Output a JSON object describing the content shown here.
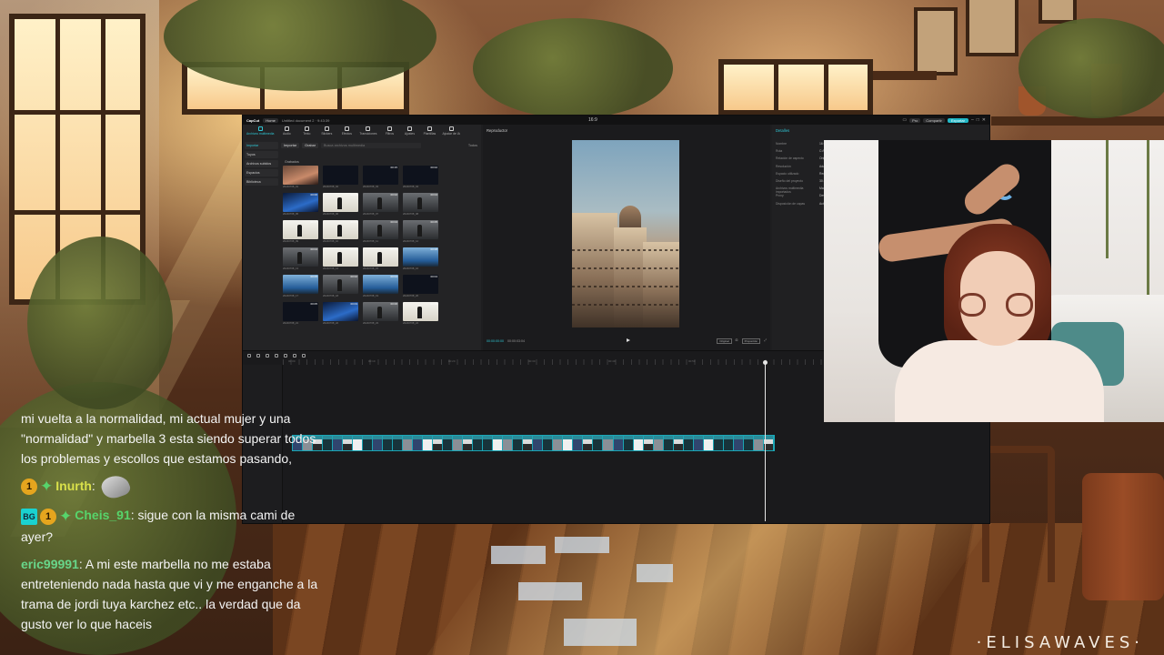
{
  "editor": {
    "titlebar": {
      "app_name": "CapCut",
      "home_label": "Home",
      "document_tab": "Untitled document 2 · 9:43:39",
      "center_title": "16:9",
      "pro_label": "Pro",
      "share_label": "Compartir",
      "export_label": "Exportar"
    },
    "toolbar": [
      {
        "label": "Archivos multimedia",
        "active": true
      },
      {
        "label": "Audio"
      },
      {
        "label": "Texto"
      },
      {
        "label": "Stickers"
      },
      {
        "label": "Efectos"
      },
      {
        "label": "Transiciones"
      },
      {
        "label": "Filtros"
      },
      {
        "label": "Ajustes"
      },
      {
        "label": "Plantillas"
      },
      {
        "label": "Ajustar de IA"
      }
    ],
    "sidebar": [
      {
        "label": "Importar",
        "active": true
      },
      {
        "label": "Tuyos"
      },
      {
        "label": "Archivos subidos"
      },
      {
        "label": "Espacios"
      },
      {
        "label": "Biblioteca"
      }
    ],
    "media_header": {
      "import_label": "Importar",
      "record_label": "Grabar",
      "search_placeholder": "Busca archivos multimedia",
      "right_label": "Todos"
    },
    "folder_label": "Grabados",
    "thumbs": [
      {
        "dur": "",
        "name": "20240708_01",
        "style": "t-warm"
      },
      {
        "dur": "",
        "name": "20240708_02",
        "style": "t-dark"
      },
      {
        "dur": "00:15",
        "name": "20240708_03",
        "style": "t-dark"
      },
      {
        "dur": "00:02",
        "name": "20240708_04",
        "style": "t-dark"
      },
      {
        "dur": "00:06",
        "name": "20240708_05",
        "style": "t-blue"
      },
      {
        "dur": "00:03",
        "name": "20240708_06",
        "style": "t-white"
      },
      {
        "dur": "00:02",
        "name": "20240708_07",
        "style": "t-gray"
      },
      {
        "dur": "00:04",
        "name": "20240708_08",
        "style": "t-gray"
      },
      {
        "dur": "00:17",
        "name": "20240708_09",
        "style": "t-white"
      },
      {
        "dur": "00:03",
        "name": "20240708_10",
        "style": "t-white"
      },
      {
        "dur": "00:04",
        "name": "20240708_11",
        "style": "t-gray"
      },
      {
        "dur": "00:05",
        "name": "20240708_12",
        "style": "t-gray"
      },
      {
        "dur": "00:04",
        "name": "20240708_13",
        "style": "t-gray"
      },
      {
        "dur": "00:04",
        "name": "20240708_14",
        "style": "t-white"
      },
      {
        "dur": "00:04",
        "name": "20240708_15",
        "style": "t-white"
      },
      {
        "dur": "00:08",
        "name": "20240708_16",
        "style": "t-sky"
      },
      {
        "dur": "00:05",
        "name": "20240708_17",
        "style": "t-sky"
      },
      {
        "dur": "00:02",
        "name": "20240708_18",
        "style": "t-gray"
      },
      {
        "dur": "00:04",
        "name": "20240708_19",
        "style": "t-sky"
      },
      {
        "dur": "00:04",
        "name": "20240708_20",
        "style": "t-dark"
      },
      {
        "dur": "00:05",
        "name": "20240708_21",
        "style": "t-dark"
      },
      {
        "dur": "00:03",
        "name": "20240708_22",
        "style": "t-blue"
      },
      {
        "dur": "00:06",
        "name": "20240708_23",
        "style": "t-gray"
      },
      {
        "dur": "00:06",
        "name": "20240708_24",
        "style": "t-white"
      }
    ],
    "player": {
      "title": "Reproductor",
      "current_time": "00:00:00:00",
      "total_time": "00:00:03:04",
      "ratio_label": "Proporción",
      "quality_label": "Original"
    },
    "details": {
      "title": "Detalles",
      "rows": [
        {
          "k": "Nombre",
          "v": "16:9"
        },
        {
          "k": "Ruta",
          "v": "C:/Us"
        },
        {
          "k": "Relación de aspecto",
          "v": "Original"
        },
        {
          "k": "Resolución",
          "v": "Adaptada"
        },
        {
          "k": "Espacio utilizado",
          "v": "Rec"
        },
        {
          "k": "Diseño del proyecto",
          "v": "30.00"
        },
        {
          "k": "Archivos multimedia importados",
          "v": "Mantener"
        },
        {
          "k": "Proxy",
          "v": "Desactivado"
        },
        {
          "k": "Disposición de capas",
          "v": "Activado"
        }
      ]
    },
    "timeline": {
      "ruler_marks": [
        "00:00",
        "00:10",
        "00:20",
        "00:30",
        "00:40",
        "00:50"
      ],
      "clip_segments": 48
    }
  },
  "chat": {
    "messages": [
      {
        "user": "",
        "text": "mi vuelta a la normalidad, mi actual mujer y una \"normalidad\" y marbella 3 esta siendo superar todos los problemas y escollos que estamos pasando,"
      },
      {
        "badges": [
          "1"
        ],
        "user": "Inurth",
        "user_color": "#d9e04a",
        "text": "",
        "emote": true
      },
      {
        "badges": [
          "BG",
          "1"
        ],
        "user": "Cheis_91",
        "user_color": "#57d46b",
        "text": "sigue con la misma cami de ayer?"
      },
      {
        "user": "eric99991",
        "user_color": "#68d68a",
        "text": "A mi este marbella no me estaba entreteniendo nada hasta que vi y me enganche a la trama de jordi tuya karchez etc.. la verdad que da gusto ver lo que haceis"
      }
    ]
  },
  "watermark": "ELISAWAVES",
  "watermark_display": "·ELISAWAVES·"
}
